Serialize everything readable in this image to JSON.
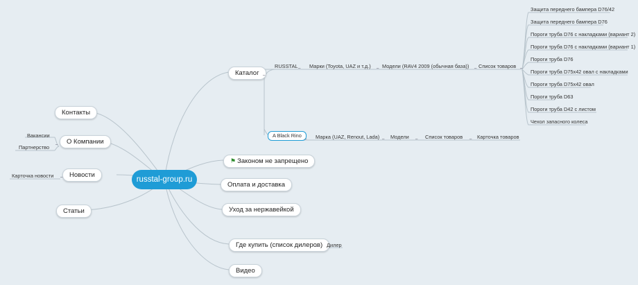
{
  "root": {
    "label": "russtal-group.ru"
  },
  "left_topics": {
    "contacts": "Контакты",
    "about": "О Компании",
    "about_children": [
      "Вакансии",
      "Партнерство"
    ],
    "news": "Новости",
    "news_child": "Карточка новости",
    "articles": "Статьи"
  },
  "right_topics": {
    "catalog": "Каталог",
    "law": "Законом не запрещено",
    "payment": "Оплата и доставка",
    "care": "Уход за нержавейкой",
    "dealers": "Где купить (список дилеров)",
    "dealer_child": "Дилер",
    "video": "Видео"
  },
  "catalog_branch": {
    "russtal": {
      "label": "RUSSTAL",
      "brands": "Марки (Toyota, UAZ и т.д.)",
      "models": "Модели (RAV4 2009 (обычная база))",
      "list": "Список товаров",
      "products": [
        "Защита переднего бампера D76/42",
        "Защита переднего бампера D76",
        "Пороги труба D76 с накладками (вариант 2)",
        "Пороги труба D76 с накладками (вариант 1)",
        "Пороги труба D76",
        "Пороги труба D75x42 овал с накладками",
        "Пороги труба D75x42 овал",
        "Пороги труба D63",
        "Пороги труба D42 с листом",
        "Чехол запасного колеса"
      ]
    },
    "black_rino": {
      "label": "A Black Rino",
      "brands": "Марка (UAZ, Renout, Lada)",
      "models": "Модели",
      "list": "Список товаров",
      "card": "Карточка товаров"
    }
  },
  "colors": {
    "root_fill": "#1f9cd6",
    "line": "#b8c4cc",
    "background": "#e6edf2",
    "flag": "#2e8b2e"
  },
  "icons": {
    "law_topic": "flag-icon",
    "toggle": "collapse-toggle-icon"
  }
}
